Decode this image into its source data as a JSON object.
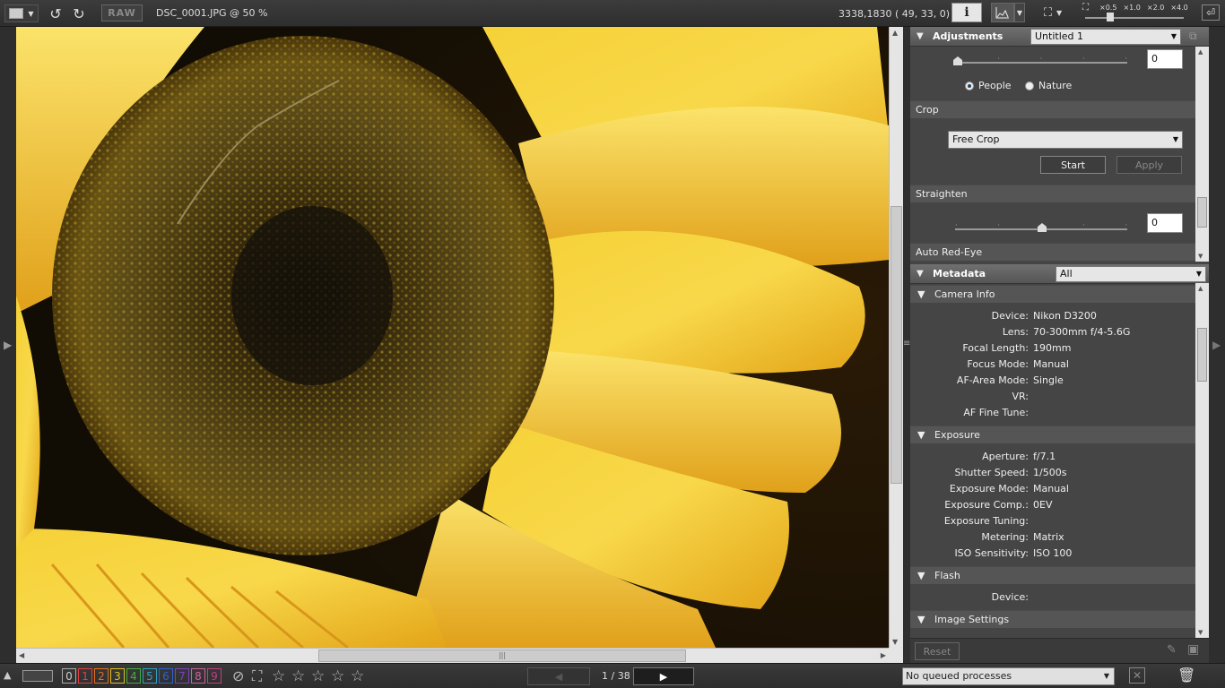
{
  "toolbar": {
    "raw_label": "RAW",
    "file_title": "DSC_0001.JPG @ 50 %",
    "coords": "3338,1830 ( 49, 33, 0)",
    "info_label": "i",
    "zoom_levels": [
      "×0.5",
      "×1.0",
      "×2.0",
      "×4.0"
    ]
  },
  "adjustments": {
    "title": "Adjustments",
    "preset": "Untitled 1",
    "slider_value": "0",
    "radio_people": "People",
    "radio_nature": "Nature",
    "crop_label": "Crop",
    "crop_mode": "Free Crop",
    "start_label": "Start",
    "apply_label": "Apply",
    "straighten_label": "Straighten",
    "straighten_value": "0",
    "redeye_label": "Auto Red-Eye"
  },
  "metadata": {
    "title": "Metadata",
    "filter": "All",
    "camera_info": {
      "label": "Camera Info",
      "rows": [
        {
          "k": "Device:",
          "v": "Nikon D3200"
        },
        {
          "k": "Lens:",
          "v": "70-300mm f/4-5.6G"
        },
        {
          "k": "Focal Length:",
          "v": "190mm"
        },
        {
          "k": "Focus Mode:",
          "v": "Manual"
        },
        {
          "k": "AF-Area Mode:",
          "v": "Single"
        },
        {
          "k": "VR:",
          "v": ""
        },
        {
          "k": "AF Fine Tune:",
          "v": ""
        }
      ]
    },
    "exposure": {
      "label": "Exposure",
      "rows": [
        {
          "k": "Aperture:",
          "v": "f/7.1"
        },
        {
          "k": "Shutter Speed:",
          "v": "1/500s"
        },
        {
          "k": "Exposure Mode:",
          "v": "Manual"
        },
        {
          "k": "Exposure Comp.:",
          "v": "0EV"
        },
        {
          "k": "Exposure Tuning:",
          "v": ""
        },
        {
          "k": "Metering:",
          "v": "Matrix"
        },
        {
          "k": "ISO Sensitivity:",
          "v": "ISO 100"
        }
      ]
    },
    "flash": {
      "label": "Flash",
      "device_k": "Device:",
      "device_v": ""
    },
    "image_settings": {
      "label": "Image Settings"
    },
    "reset_label": "Reset"
  },
  "bottom": {
    "labels": [
      "0",
      "1",
      "2",
      "3",
      "4",
      "5",
      "6",
      "7",
      "8",
      "9"
    ],
    "label_colors": [
      "#cccccc",
      "#e04040",
      "#e07020",
      "#e0c020",
      "#40b040",
      "#30a0c0",
      "#3060d0",
      "#8040c0",
      "#d060a0",
      "#c04080"
    ],
    "page": "1 / 38",
    "queue": "No queued processes"
  }
}
